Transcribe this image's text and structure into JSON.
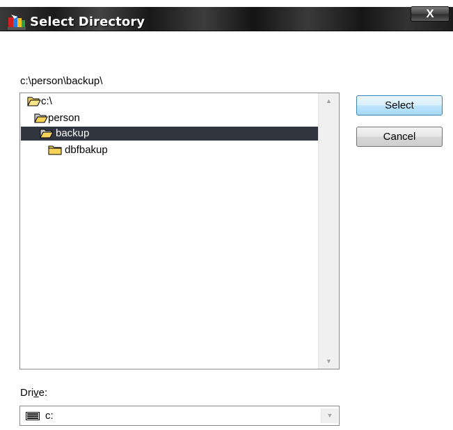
{
  "window": {
    "title": "Select Directory",
    "close_label": "X"
  },
  "path": "c:\\person\\backup\\",
  "tree": {
    "items": [
      {
        "label": "c:\\",
        "state": "open"
      },
      {
        "label": "person",
        "state": "open"
      },
      {
        "label": "backup",
        "state": "open",
        "selected": true
      },
      {
        "label": "dbfbakup",
        "state": "closed"
      }
    ]
  },
  "buttons": {
    "select_label": "Select",
    "cancel_label": "Cancel"
  },
  "drive": {
    "label_pre": "Dri",
    "label_accel": "v",
    "label_post": "e:",
    "value": "c:"
  },
  "icons": {
    "app": "colorful-app-icon",
    "folder_open": "folder-open-icon",
    "folder_closed": "folder-closed-icon",
    "drive": "hard-drive-icon",
    "scroll_up": "scroll-up-arrow-icon",
    "scroll_down": "scroll-down-arrow-icon",
    "dropdown": "chevron-down-icon"
  },
  "colors": {
    "selection_bg": "#303540",
    "folder_yellow": "#f5d35a",
    "select_button_border": "#3c7fb1"
  }
}
